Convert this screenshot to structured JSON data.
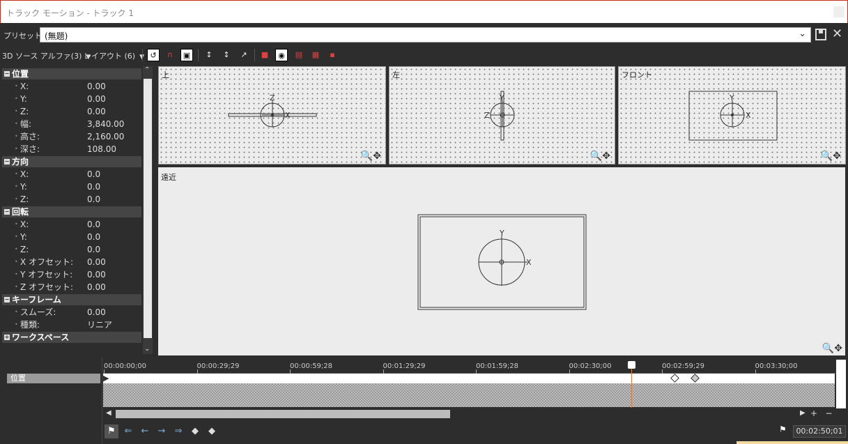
{
  "window": {
    "title": "トラック モーション - トラック 1"
  },
  "preset": {
    "label": "プリセット:",
    "value": "(無題)"
  },
  "toolbar": {
    "source_alpha": "3D ソース アルファ(3)",
    "layout": "レイアウト (6)"
  },
  "sections": [
    {
      "title": "位置",
      "rows": [
        [
          "X:",
          "0.00"
        ],
        [
          "Y:",
          "0.00"
        ],
        [
          "Z:",
          "0.00"
        ],
        [
          "幅:",
          "3,840.00"
        ],
        [
          "高さ:",
          "2,160.00"
        ],
        [
          "深さ:",
          "108.00"
        ]
      ]
    },
    {
      "title": "方向",
      "rows": [
        [
          "X:",
          "0.0"
        ],
        [
          "Y:",
          "0.0"
        ],
        [
          "Z:",
          "0.0"
        ]
      ]
    },
    {
      "title": "回転",
      "rows": [
        [
          "X:",
          "0.0"
        ],
        [
          "Y:",
          "0.0"
        ],
        [
          "Z:",
          "0.0"
        ],
        [
          "X オフセット:",
          "0.00"
        ],
        [
          "Y オフセット:",
          "0.00"
        ],
        [
          "Z オフセット:",
          "0.00"
        ]
      ]
    },
    {
      "title": "キーフレーム",
      "rows": [
        [
          "スムーズ:",
          "0.00"
        ],
        [
          "種類:",
          "リニア"
        ]
      ]
    },
    {
      "title": "ワークスペース",
      "rows": []
    }
  ],
  "views": {
    "top": "上",
    "left": "左",
    "front": "フロント",
    "perspective": "遠近"
  },
  "axes": {
    "x": "X",
    "y": "Y",
    "z": "Z"
  },
  "timeline": {
    "row_label": "位置",
    "ticks": [
      "00:00:00;00",
      "00:00:29;29",
      "00:00:59;28",
      "00:01:29;29",
      "00:01:59;28",
      "00:02:30;00",
      "00:02:59;29",
      "00:03:30;00"
    ],
    "timecode": "00:02:50;01",
    "plus": "+",
    "minus": "−"
  },
  "colors": {
    "accent_cursor": "#d57a3a",
    "title_border": "#c42b1c"
  }
}
